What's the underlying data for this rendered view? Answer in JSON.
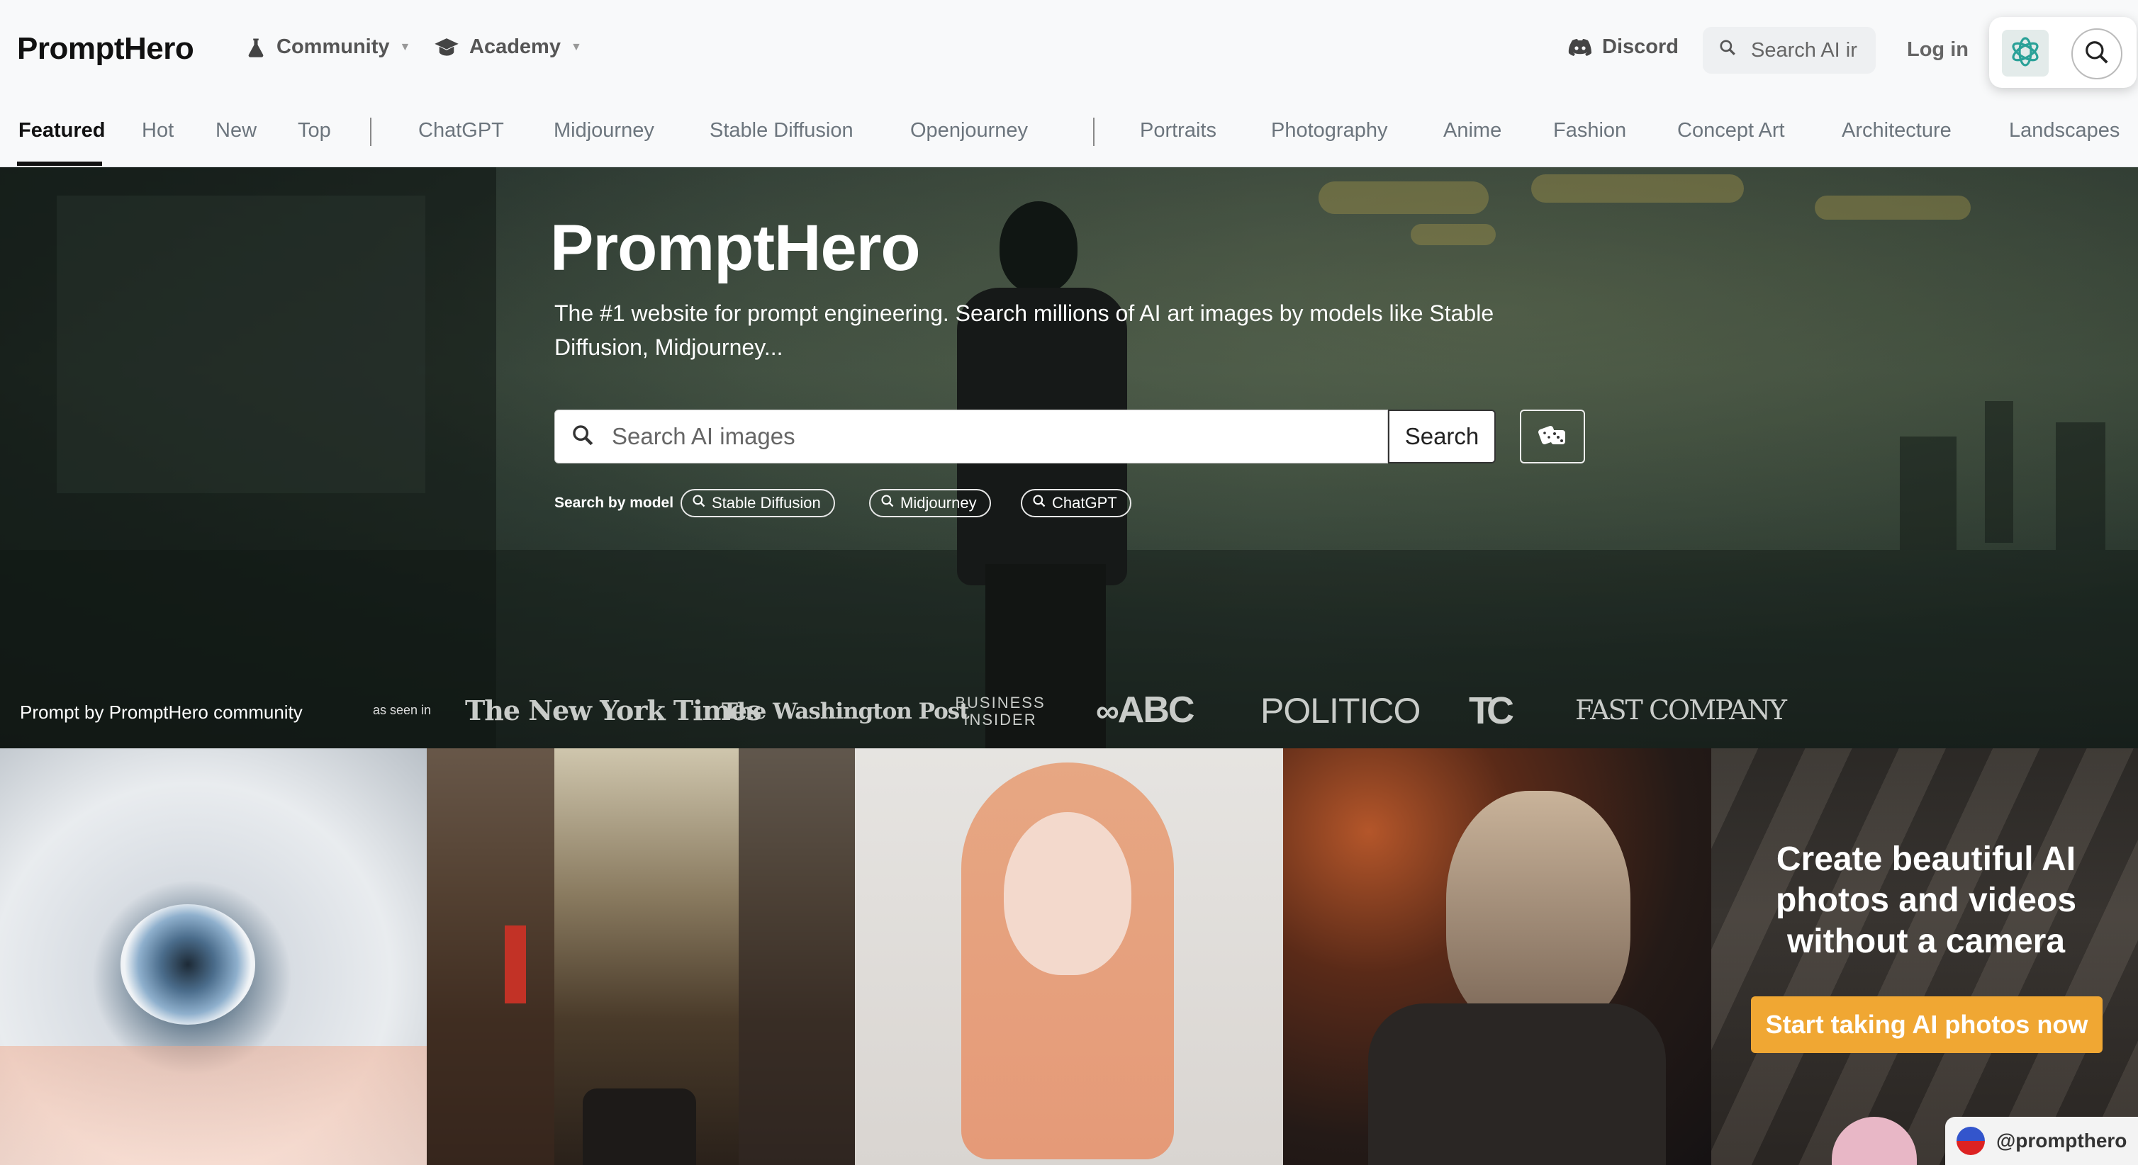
{
  "topbar": {
    "brand": "PromptHero",
    "community_label": "Community",
    "academy_label": "Academy",
    "discord_label": "Discord",
    "search_placeholder": "Search AI ir",
    "login_label": "Log in"
  },
  "categories": {
    "sort": [
      "Featured",
      "Hot",
      "New",
      "Top"
    ],
    "models": [
      "ChatGPT",
      "Midjourney",
      "Stable Diffusion",
      "Openjourney"
    ],
    "topics": [
      "Portraits",
      "Photography",
      "Anime",
      "Fashion",
      "Concept Art",
      "Architecture",
      "Landscapes"
    ],
    "active": "Featured"
  },
  "hero": {
    "title": "PromptHero",
    "subtitle": "The #1 website for prompt engineering. Search millions of AI art images by models like Stable Diffusion, Midjourney...",
    "search_placeholder": "Search AI images",
    "search_button": "Search",
    "search_by_model_label": "Search by model",
    "model_pills": [
      "Stable Diffusion",
      "Midjourney",
      "ChatGPT"
    ],
    "credit": "Prompt by PromptHero community",
    "as_seen_in": "as seen in",
    "press_logos": [
      "The New York Times",
      "The Washington Post",
      "BUSINESS INSIDER",
      "ABC",
      "POLITICO",
      "TC",
      "FAST COMPANY"
    ]
  },
  "promo": {
    "title": "Create beautiful AI photos and videos without a camera",
    "button": "Start taking AI photos now",
    "handle": "@prompthero"
  },
  "colors": {
    "accent_orange": "#f0a733",
    "nav_bg": "#f8f9fa"
  }
}
